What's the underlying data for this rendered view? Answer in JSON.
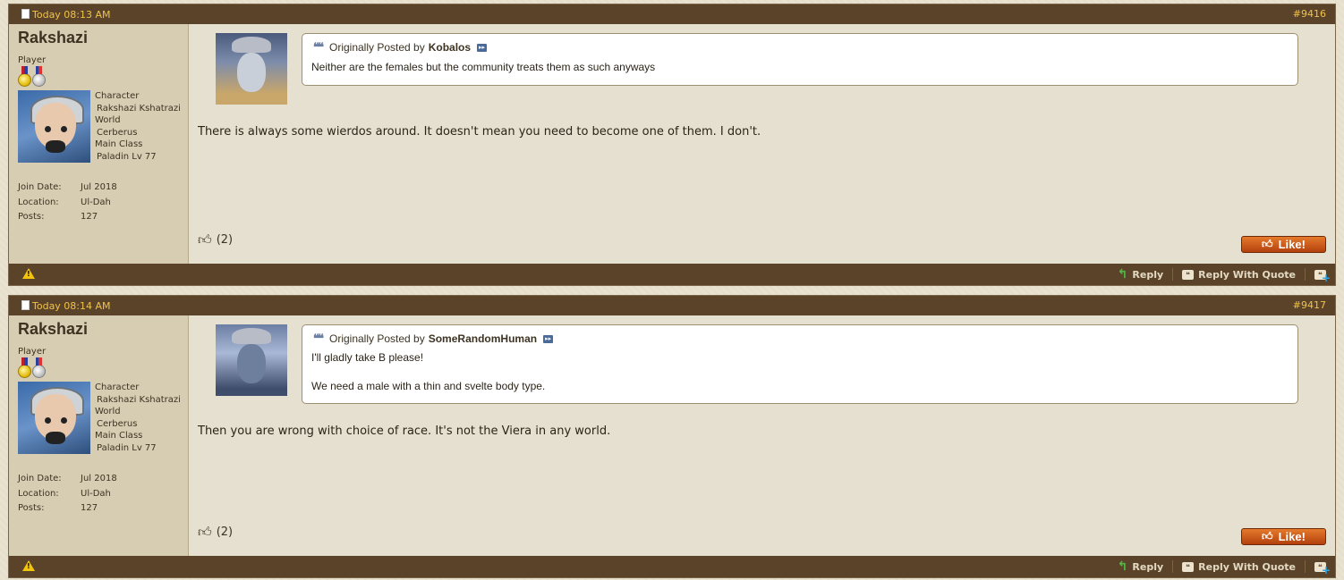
{
  "posts": [
    {
      "date": "Today 08:13 AM",
      "number": "#9416",
      "user": {
        "name": "Rakshazi",
        "title": "Player",
        "character_label": "Character",
        "character": "Rakshazi Kshatrazi",
        "world_label": "World",
        "world": "Cerberus",
        "class_label": "Main Class",
        "class": "Paladin Lv 77",
        "join_label": "Join Date:",
        "join": "Jul 2018",
        "location_label": "Location:",
        "location": "Ul-Dah",
        "posts_label": "Posts:",
        "posts": "127"
      },
      "quote": {
        "prefix": "Originally Posted by",
        "author": "Kobalos",
        "lines": [
          "Neither are the females but the community treats them as such anyways"
        ]
      },
      "message": "There is always some wierdos around. It doesn't mean you need to become one of them. I don't.",
      "likes": "(2)",
      "like_button": "Like!"
    },
    {
      "date": "Today 08:14 AM",
      "number": "#9417",
      "user": {
        "name": "Rakshazi",
        "title": "Player",
        "character_label": "Character",
        "character": "Rakshazi Kshatrazi",
        "world_label": "World",
        "world": "Cerberus",
        "class_label": "Main Class",
        "class": "Paladin Lv 77",
        "join_label": "Join Date:",
        "join": "Jul 2018",
        "location_label": "Location:",
        "location": "Ul-Dah",
        "posts_label": "Posts:",
        "posts": "127"
      },
      "quote": {
        "prefix": "Originally Posted by",
        "author": "SomeRandomHuman",
        "lines": [
          "I'll gladly take B please!",
          "We need a male with a thin and svelte body type."
        ]
      },
      "message": "Then you are wrong with choice of race. It's not the Viera in any world.",
      "likes": "(2)",
      "like_button": "Like!"
    }
  ],
  "footer": {
    "reply": "Reply",
    "reply_with_quote": "Reply With Quote"
  },
  "icons": {
    "post_icon": "document-icon",
    "report": "warning-icon",
    "reply": "reply-arrow-icon",
    "quote": "quote-bubble-icon",
    "multiquote": "multi-quote-plus-icon",
    "like": "thumbs-up-icon"
  }
}
